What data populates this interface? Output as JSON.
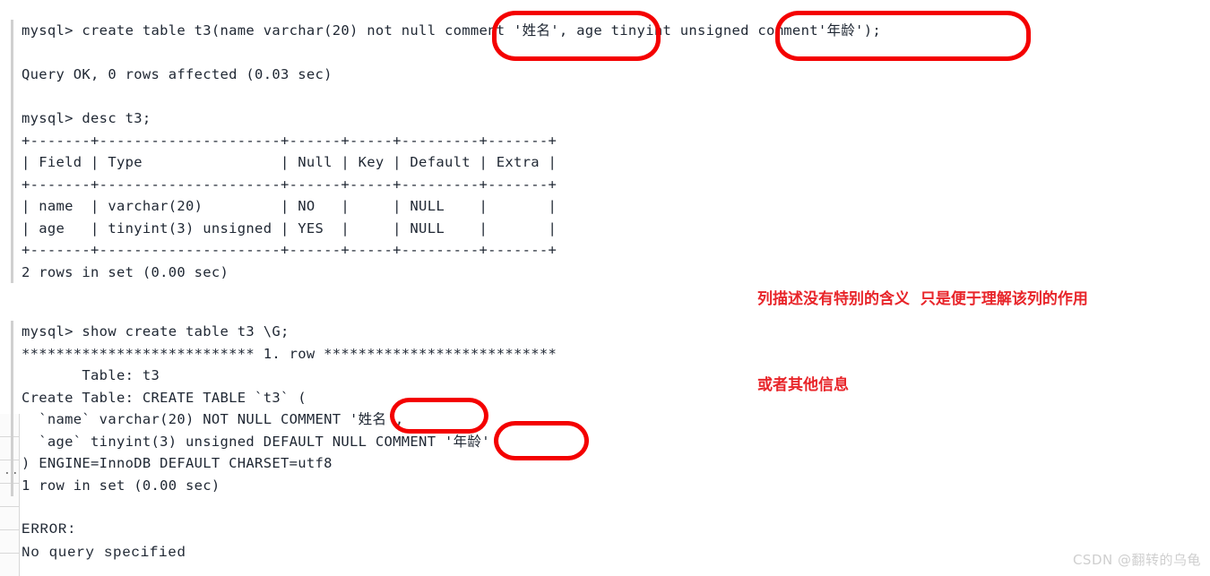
{
  "colors": {
    "background": "#ffffff",
    "terminal_text": "#1f2733",
    "annotation_red": "#f40000",
    "note_red": "#e8252a",
    "panel_border": "#d0d0d0",
    "watermark": "#cfcfcf"
  },
  "panel_1": {
    "name": "mysql-create-table-panel",
    "lines": [
      "mysql> create table t3(name varchar(20) not null comment '姓名', age tinyint unsigned comment'年龄');",
      "",
      "Query OK, 0 rows affected (0.03 sec)",
      "",
      "mysql> desc t3;",
      "+-------+---------------------+------+-----+---------+-------+",
      "| Field | Type                | Null | Key | Default | Extra |",
      "+-------+---------------------+------+-----+---------+-------+",
      "| name  | varchar(20)         | NO   |     | NULL    |       |",
      "| age   | tinyint(3) unsigned | YES  |     | NULL    |       |",
      "+-------+---------------------+------+-----+---------+-------+",
      "2 rows in set (0.00 sec)"
    ],
    "desc_table": {
      "headers": [
        "Field",
        "Type",
        "Null",
        "Key",
        "Default",
        "Extra"
      ],
      "rows": [
        [
          "name",
          "varchar(20)",
          "NO",
          "",
          "NULL",
          ""
        ],
        [
          "age",
          "tinyint(3) unsigned",
          "YES",
          "",
          "NULL",
          ""
        ]
      ],
      "footer": "2 rows in set (0.00 sec)"
    },
    "commands": {
      "create_table": "create table t3(name varchar(20) not null comment '姓名', age tinyint unsigned comment'年龄');",
      "desc": "desc t3;",
      "create_result": "Query OK, 0 rows affected (0.03 sec)"
    }
  },
  "panel_2": {
    "name": "show-create-table-panel",
    "lines": [
      "mysql> show create table t3 \\G;",
      "*************************** 1. row ***************************",
      "       Table: t3",
      "Create Table: CREATE TABLE `t3` (",
      "  `name` varchar(20) NOT NULL COMMENT '姓名',",
      "  `age` tinyint(3) unsigned DEFAULT NULL COMMENT '年龄'",
      ") ENGINE=InnoDB DEFAULT CHARSET=utf8",
      "1 row in set (0.00 sec)"
    ],
    "command": "show create table t3 \\G;",
    "row_header": "*************************** 1. row ***************************",
    "table_name_field": "       Table: t3",
    "ddl": [
      "Create Table: CREATE TABLE `t3` (",
      "  `name` varchar(20) NOT NULL COMMENT '姓名',",
      "  `age` tinyint(3) unsigned DEFAULT NULL COMMENT '年龄'",
      ") ENGINE=InnoDB DEFAULT CHARSET=utf8"
    ],
    "footer": "1 row in set (0.00 sec)"
  },
  "error_block": {
    "name": "mysql-error-output",
    "lines": [
      "ERROR:",
      "No query specified"
    ]
  },
  "annotations": {
    "ellipse_1_label": "comment '姓名',",
    "ellipse_2_label": "unsigned comment'年龄');",
    "ellipse_3_label": "'姓名',",
    "ellipse_4_label": "'年龄'"
  },
  "note": {
    "name": "column-comment-note",
    "line1": "列描述没有特别的含义  只是便于理解该列的作用",
    "line2": "或者其他信息"
  },
  "watermark": {
    "text": "CSDN @翻转的乌龟"
  }
}
